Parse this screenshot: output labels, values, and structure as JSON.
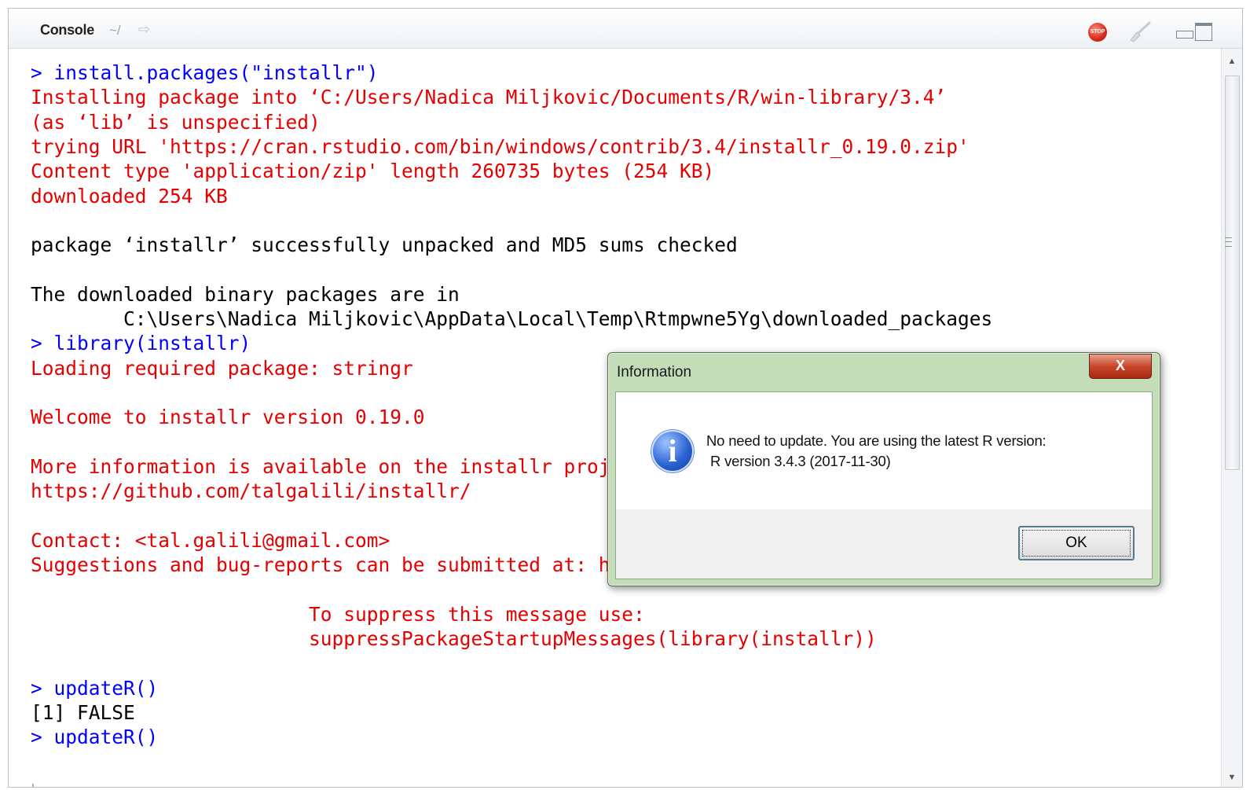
{
  "pane": {
    "title": "Console",
    "path": "~/"
  },
  "console": {
    "lines": [
      {
        "text": "> install.packages(\"installr\")",
        "kind": "cmd"
      },
      {
        "text": "Installing package into ‘C:/Users/Nadica Miljkovic/Documents/R/win-library/3.4’",
        "kind": "msg"
      },
      {
        "text": "(as ‘lib’ is unspecified)",
        "kind": "msg"
      },
      {
        "text": "trying URL 'https://cran.rstudio.com/bin/windows/contrib/3.4/installr_0.19.0.zip'",
        "kind": "msg"
      },
      {
        "text": "Content type 'application/zip' length 260735 bytes (254 KB)",
        "kind": "msg"
      },
      {
        "text": "downloaded 254 KB",
        "kind": "msg"
      },
      {
        "text": "",
        "kind": "out"
      },
      {
        "text": "package ‘installr’ successfully unpacked and MD5 sums checked",
        "kind": "out"
      },
      {
        "text": "",
        "kind": "out"
      },
      {
        "text": "The downloaded binary packages are in",
        "kind": "out"
      },
      {
        "text": "        C:\\Users\\Nadica Miljkovic\\AppData\\Local\\Temp\\Rtmpwne5Yg\\downloaded_packages",
        "kind": "out"
      },
      {
        "text": "> library(installr)",
        "kind": "cmd"
      },
      {
        "text": "Loading required package: stringr",
        "kind": "msg"
      },
      {
        "text": "",
        "kind": "msg"
      },
      {
        "text": "Welcome to installr version 0.19.0",
        "kind": "msg"
      },
      {
        "text": "",
        "kind": "msg"
      },
      {
        "text": "More information is available on the installr project website:",
        "kind": "msg"
      },
      {
        "text": "https://github.com/talgalili/installr/",
        "kind": "msg"
      },
      {
        "text": "",
        "kind": "msg"
      },
      {
        "text": "Contact: <tal.galili@gmail.com>",
        "kind": "msg"
      },
      {
        "text": "Suggestions and bug-reports can be submitted at: https://github.com/talgalili/installr/issues",
        "kind": "msg"
      },
      {
        "text": "",
        "kind": "msg"
      },
      {
        "text": "                        To suppress this message use:",
        "kind": "msg"
      },
      {
        "text": "                        suppressPackageStartupMessages(library(installr))",
        "kind": "msg"
      },
      {
        "text": "",
        "kind": "msg"
      },
      {
        "text": "> updateR()",
        "kind": "cmd"
      },
      {
        "text": "[1] FALSE",
        "kind": "out"
      },
      {
        "text": "> updateR()",
        "kind": "cmd"
      }
    ]
  },
  "toolbar": {
    "stop_label": "STOP",
    "icons": [
      "goto-directory-icon",
      "stop-icon",
      "clear-console-icon",
      "minimize-icon",
      "maximize-icon"
    ]
  },
  "colors": {
    "command": "#0000ff",
    "message": "#e60000",
    "output": "#000000",
    "dialog_frame": "#c2ddb8"
  },
  "dialog": {
    "title": "Information",
    "close_label": "X",
    "icon": "information-icon",
    "message_line1": "No need to update. You are using the latest R version:",
    "message_line2": "R version 3.4.3 (2017-11-30)",
    "ok_label": "OK"
  }
}
